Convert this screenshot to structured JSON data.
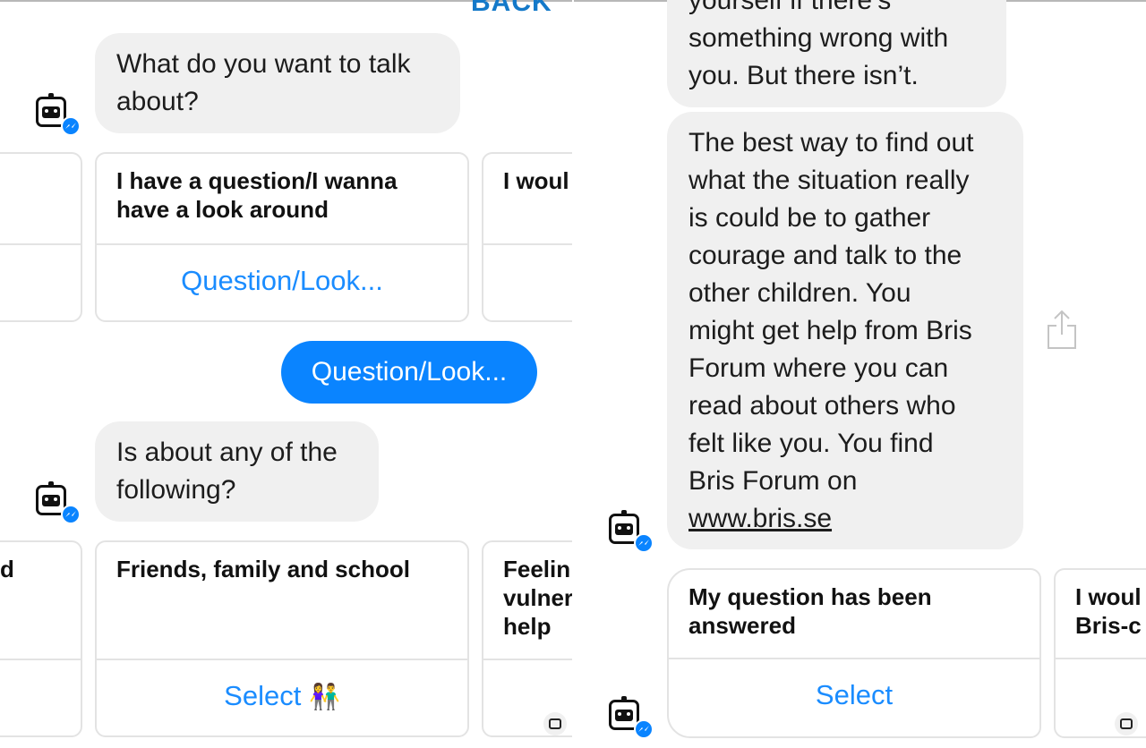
{
  "left": {
    "header_partial": "BACK",
    "bot_msg_1": [
      "What do you want to talk",
      "about?"
    ],
    "cards_row_1": {
      "left_partial": {
        "title": ""
      },
      "main": {
        "title_lines": [
          "I have a question/I wanna",
          "have a look around"
        ],
        "action": "Question/Look..."
      },
      "right_partial": {
        "title": "I woul"
      }
    },
    "user_reply": "Question/Look...",
    "bot_msg_2": [
      "Is about any of the",
      "following?"
    ],
    "cards_row_2": {
      "left_partial": {
        "title": "d"
      },
      "main": {
        "title": "Friends, family and school",
        "action": "Select",
        "action_emoji": "👫"
      },
      "right_partial": {
        "title_lines": [
          "Feelin",
          "vulner",
          "help"
        ]
      }
    }
  },
  "right": {
    "msg_top_lines": [
      "yourself if there’s",
      "something wrong with",
      "you. But there isn’t."
    ],
    "msg_main_lines": [
      "The best way to find out",
      "what the situation really",
      "is could be to gather",
      "courage and talk to the",
      "other children. You",
      "might get help from Bris",
      "Forum where you can",
      "read about others who",
      "felt like you. You find",
      "Bris Forum on"
    ],
    "msg_link": "www.bris.se",
    "cards": {
      "main": {
        "title_lines": [
          "My question has been",
          "answered"
        ],
        "action": "Select"
      },
      "right_partial": {
        "title_lines": [
          "I woul",
          "Bris-c"
        ]
      }
    }
  },
  "icons": {
    "bot_avatar": "robot-face-icon",
    "messenger_badge": "messenger-badge-icon",
    "share": "share-icon"
  },
  "colors": {
    "accent": "#0a84ff",
    "link_blue": "#1a8cff",
    "bubble_gray": "#f0f0f0",
    "header_blue": "#1479c9"
  }
}
